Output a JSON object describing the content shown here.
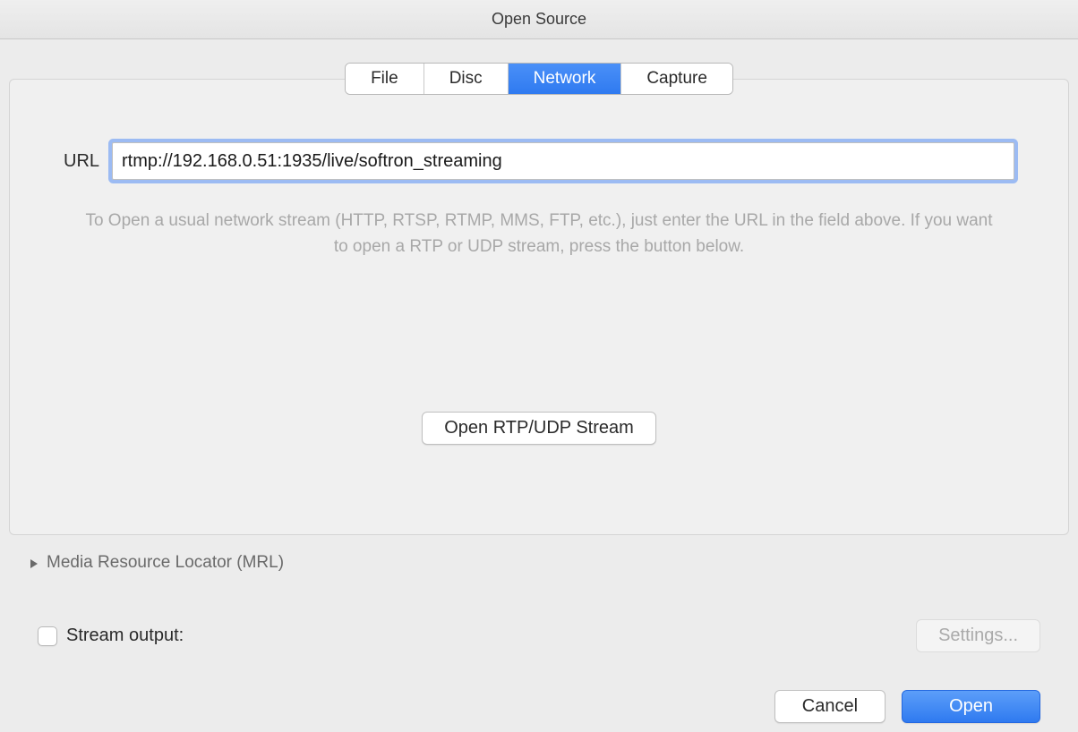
{
  "window": {
    "title": "Open Source"
  },
  "tabs": {
    "file": "File",
    "disc": "Disc",
    "network": "Network",
    "capture": "Capture",
    "active": "network"
  },
  "url": {
    "label": "URL",
    "value": "rtmp://192.168.0.51:1935/live/softron_streaming"
  },
  "help": {
    "text": "To Open a usual network stream (HTTP, RTSP, RTMP, MMS, FTP, etc.), just enter the URL in the field above. If you want to open a RTP or UDP stream, press the button below."
  },
  "rtp_button": {
    "label": "Open RTP/UDP Stream"
  },
  "mrl": {
    "label": "Media Resource Locator (MRL)"
  },
  "stream_output": {
    "label": "Stream output:",
    "checked": false,
    "settings_label": "Settings..."
  },
  "footer": {
    "cancel": "Cancel",
    "open": "Open"
  }
}
